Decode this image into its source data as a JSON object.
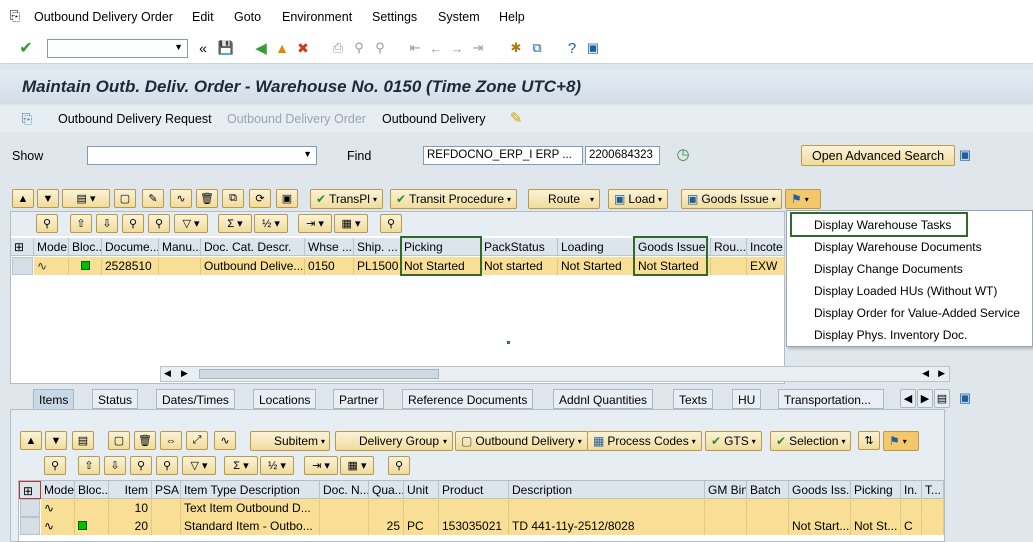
{
  "menu": {
    "items": [
      "Outbound Delivery Order",
      "Edit",
      "Goto",
      "Environment",
      "Settings",
      "System",
      "Help"
    ]
  },
  "title": "Maintain Outb. Deliv. Order - Warehouse No. 0150 (Time Zone UTC+8)",
  "appbar": {
    "request": "Outbound Delivery Request",
    "order": "Outbound Delivery Order",
    "delivery": "Outbound Delivery"
  },
  "search": {
    "show_label": "Show",
    "find_label": "Find",
    "find_field": "REFDOCNO_ERP_I ERP ...",
    "find_value": "2200684323",
    "advanced": "Open Advanced Search"
  },
  "toolbar_top": {
    "transpl": "TransPl",
    "transit": "Transit Procedure",
    "route": "Route",
    "load": "Load",
    "goods_issue": "Goods Issue"
  },
  "grid_top": {
    "headers": [
      "Mode",
      "Bloc...",
      "Docume...",
      "Manu...",
      "Doc. Cat. Descr.",
      "Whse ...",
      "Ship. ...",
      "Picking",
      "PackStatus",
      "Loading",
      "Goods Issue",
      "Rou...",
      "Incote"
    ],
    "row": [
      "",
      "",
      "2528510",
      "",
      "Outbound Delive...",
      "0150",
      "PL1500",
      "Not Started",
      "Not started",
      "Not Started",
      "Not Started",
      "",
      "EXW"
    ]
  },
  "dropdown": {
    "items": [
      "Display Warehouse Tasks",
      "Display Warehouse Documents",
      "Display Change Documents",
      "Display Loaded HUs (Without WT)",
      "Display Order for Value-Added Service",
      "Display Phys. Inventory Doc."
    ]
  },
  "tabs": [
    "Items",
    "Status",
    "Dates/Times",
    "Locations",
    "Partner",
    "Reference Documents",
    "Addnl Quantities",
    "Texts",
    "HU",
    "Transportation..."
  ],
  "toolbar_bottom": {
    "subitem": "Subitem",
    "delivery_group": "Delivery Group",
    "outbound_delivery": "Outbound Delivery",
    "process_codes": "Process Codes",
    "gts": "GTS",
    "selection": "Selection"
  },
  "grid_bottom": {
    "headers": [
      "Mode",
      "Bloc...",
      "Item",
      "PSA",
      "Item Type Description",
      "Doc. N...",
      "Qua...",
      "Unit",
      "Product",
      "Description",
      "GM Bin",
      "Batch",
      "Goods Iss.",
      "Picking",
      "In.",
      "T..."
    ],
    "rows": [
      [
        "",
        "",
        "10",
        "",
        "Text Item Outbound D...",
        "",
        "",
        "",
        "",
        "",
        "",
        "",
        "",
        "",
        "",
        ""
      ],
      [
        "",
        "",
        "20",
        "",
        "Standard Item - Outbo...",
        "",
        "25",
        "PC",
        "153035021",
        "TD 441-11y-2512/8028",
        "",
        "",
        "Not Start...",
        "Not St...",
        "C",
        ""
      ]
    ]
  },
  "colors": {
    "row_highlight": "#f9df96",
    "highlight_box": "#2e6b2a",
    "title_bg": "#d2dde7"
  }
}
